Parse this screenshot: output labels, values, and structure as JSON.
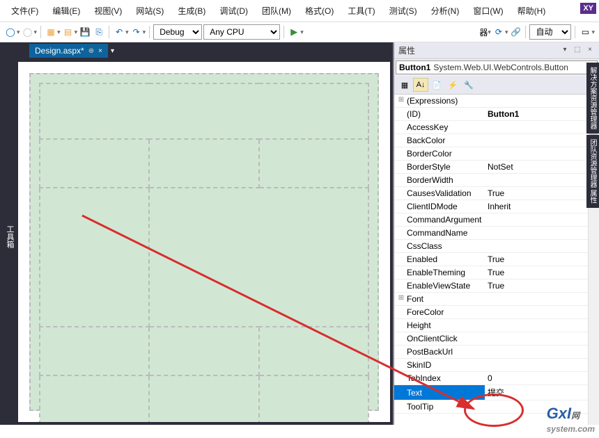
{
  "menubar": {
    "items": [
      "文件(F)",
      "编辑(E)",
      "视图(V)",
      "网站(S)",
      "生成(B)",
      "调试(D)",
      "团队(M)",
      "格式(O)",
      "工具(T)",
      "测试(S)",
      "分析(N)",
      "窗口(W)",
      "帮助(H)"
    ]
  },
  "logo": "XY",
  "toolbar": {
    "config": "Debug",
    "platform": "Any CPU",
    "attach_hint": "器",
    "auto": "自动"
  },
  "left_rail": "工具箱",
  "doc_tab": {
    "title": "Design.aspx*",
    "pin": "⊕",
    "close": "×"
  },
  "right_rails": [
    "解决方案资源管理器",
    "团队资源管理器 属性"
  ],
  "properties": {
    "title": "属性",
    "object_name": "Button1",
    "object_type": "System.Web.UI.WebControls.Button",
    "rows": [
      {
        "name": "(Expressions)",
        "value": "",
        "expand": "⊞"
      },
      {
        "name": "(ID)",
        "value": "Button1",
        "bold": true
      },
      {
        "name": "AccessKey",
        "value": ""
      },
      {
        "name": "BackColor",
        "value": ""
      },
      {
        "name": "BorderColor",
        "value": ""
      },
      {
        "name": "BorderStyle",
        "value": "NotSet"
      },
      {
        "name": "BorderWidth",
        "value": ""
      },
      {
        "name": "CausesValidation",
        "value": "True"
      },
      {
        "name": "ClientIDMode",
        "value": "Inherit"
      },
      {
        "name": "CommandArgument",
        "value": ""
      },
      {
        "name": "CommandName",
        "value": ""
      },
      {
        "name": "CssClass",
        "value": ""
      },
      {
        "name": "Enabled",
        "value": "True"
      },
      {
        "name": "EnableTheming",
        "value": "True"
      },
      {
        "name": "EnableViewState",
        "value": "True"
      },
      {
        "name": "Font",
        "value": "",
        "expand": "⊞"
      },
      {
        "name": "ForeColor",
        "value": ""
      },
      {
        "name": "Height",
        "value": ""
      },
      {
        "name": "OnClientClick",
        "value": ""
      },
      {
        "name": "PostBackUrl",
        "value": ""
      },
      {
        "name": "SkinID",
        "value": ""
      },
      {
        "name": "TabIndex",
        "value": "0"
      },
      {
        "name": "Text",
        "value": "提交",
        "selected": true
      },
      {
        "name": "ToolTip",
        "value": ""
      }
    ]
  },
  "watermark": {
    "brand": "GxI",
    "suffix": "网",
    "domain": "system.com"
  }
}
